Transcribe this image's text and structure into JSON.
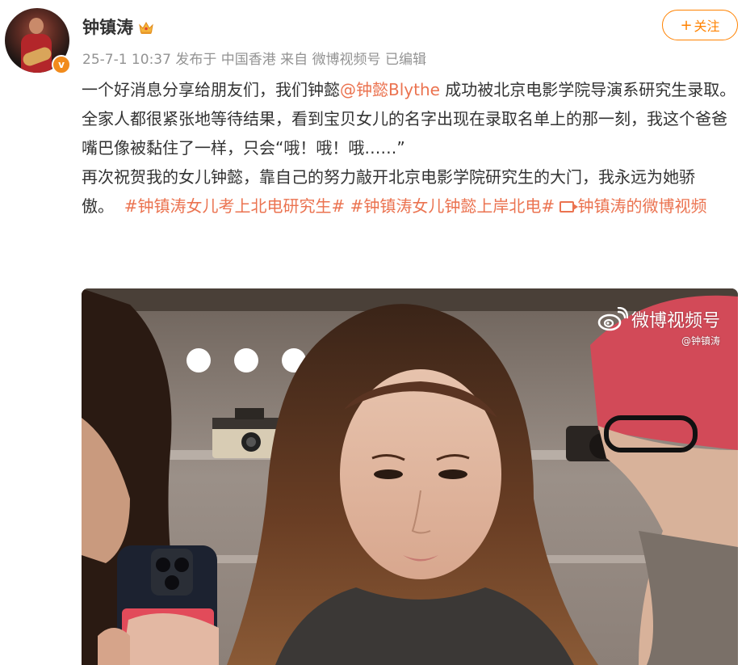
{
  "author": {
    "name": "钟镇涛",
    "badge_icon": "crown-icon",
    "verified_icon": "verified-icon",
    "verified_glyph": "v"
  },
  "meta": {
    "time": "25-7-1 10:37",
    "posted_from_label": "发布于",
    "location": "中国香港",
    "via_label": "来自",
    "source": "微博视频号",
    "edited_label": "已编辑"
  },
  "follow": {
    "plus": "+",
    "label": "关注"
  },
  "post": {
    "p1_text": "一个好消息分享给朋友们，我们钟懿",
    "p1_mention": "@钟懿Blythe",
    "p1_rest": " 成功被北京电影学院导演系研究生录取。",
    "p2_text": "全家人都很紧张地等待结果，看到宝贝女儿的名字出现在录取名单上的那一刻，我这个爸爸嘴巴像被黏住了一样，只会“哦！哦！哦……”",
    "p3_text": "再次祝贺我的女儿钟懿，靠自己的努力敲开北京电影学院研究生的大门，我永远为她骄傲。",
    "hashtag1": "#钟镇涛女儿考上北电研究生#",
    "hashtag2": "#钟镇涛女儿钟懿上岸北电#",
    "video_link": "钟镇涛的微博视频"
  },
  "video": {
    "watermark_main": "微博视频号",
    "watermark_sub": "@钟镇涛"
  },
  "colors": {
    "accent": "#ff8200",
    "link": "#eb7350",
    "meta_gray": "#939393",
    "text": "#333333"
  }
}
